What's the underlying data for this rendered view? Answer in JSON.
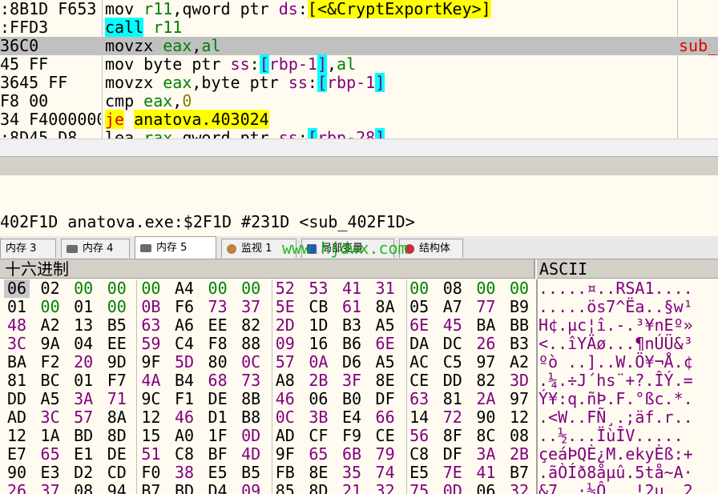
{
  "disasm": {
    "rows": [
      {
        "bytes": ":8B1D F653",
        "instr": [
          {
            "t": "mov ",
            "c": "plain"
          },
          {
            "t": "r11",
            "c": "reg"
          },
          {
            "t": ",",
            "c": "plain"
          },
          {
            "t": "qword ptr ",
            "c": "plain"
          },
          {
            "t": "ds",
            "c": "seg"
          },
          {
            "t": ":",
            "c": "plain"
          },
          {
            "t": "[<&CryptExportKey>]",
            "c": "callhl"
          }
        ],
        "selected": false,
        "comment": ""
      },
      {
        "bytes": ":FFD3",
        "instr": [
          {
            "t": "call",
            "c": "cyan"
          },
          {
            "t": " ",
            "c": "plain"
          },
          {
            "t": "r11",
            "c": "reg"
          }
        ],
        "selected": false,
        "comment": ""
      },
      {
        "bytes": "36C0",
        "instr": [
          {
            "t": "movzx ",
            "c": "plain"
          },
          {
            "t": "eax",
            "c": "reg"
          },
          {
            "t": ",",
            "c": "plain"
          },
          {
            "t": "al",
            "c": "reg"
          }
        ],
        "selected": true,
        "comment": "sub_"
      },
      {
        "bytes": "45 FF",
        "instr": [
          {
            "t": "mov ",
            "c": "plain"
          },
          {
            "t": "byte ptr ",
            "c": "plain"
          },
          {
            "t": "ss",
            "c": "seg"
          },
          {
            "t": ":",
            "c": "plain"
          },
          {
            "t": "[",
            "c": "br"
          },
          {
            "t": "rbp-1",
            "c": "mem"
          },
          {
            "t": "]",
            "c": "br"
          },
          {
            "t": ",",
            "c": "plain"
          },
          {
            "t": "al",
            "c": "reg"
          }
        ],
        "selected": false,
        "comment": ""
      },
      {
        "bytes": "3645 FF",
        "instr": [
          {
            "t": "movzx ",
            "c": "plain"
          },
          {
            "t": "eax",
            "c": "reg"
          },
          {
            "t": ",",
            "c": "plain"
          },
          {
            "t": "byte ptr ",
            "c": "plain"
          },
          {
            "t": "ss",
            "c": "seg"
          },
          {
            "t": ":",
            "c": "plain"
          },
          {
            "t": "[",
            "c": "br"
          },
          {
            "t": "rbp-1",
            "c": "mem"
          },
          {
            "t": "]",
            "c": "br"
          }
        ],
        "selected": false,
        "comment": ""
      },
      {
        "bytes": "F8 00",
        "instr": [
          {
            "t": "cmp ",
            "c": "plain"
          },
          {
            "t": "eax",
            "c": "reg"
          },
          {
            "t": ",",
            "c": "plain"
          },
          {
            "t": "0",
            "c": "num"
          }
        ],
        "selected": false,
        "comment": ""
      },
      {
        "bytes": "34 F4000000",
        "instr": [
          {
            "t": "je",
            "c": "jmp"
          },
          {
            "t": " ",
            "c": "plain"
          },
          {
            "t": "anatova.403024",
            "c": "yellow"
          }
        ],
        "selected": false,
        "comment": ""
      },
      {
        "bytes": ":8D45 D8",
        "instr": [
          {
            "t": "lea ",
            "c": "plain"
          },
          {
            "t": "rax",
            "c": "reg"
          },
          {
            "t": ",",
            "c": "plain"
          },
          {
            "t": "qword ptr ",
            "c": "plain"
          },
          {
            "t": "ss",
            "c": "seg"
          },
          {
            "t": ":",
            "c": "plain"
          },
          {
            "t": "[",
            "c": "br"
          },
          {
            "t": "rbp-28",
            "c": "mem"
          },
          {
            "t": "]",
            "c": "br"
          }
        ],
        "selected": false,
        "comment": ""
      }
    ]
  },
  "info": {
    "line": "402F1D anatova.exe:$2F1D #231D <sub_402F1D>"
  },
  "tabs": [
    {
      "label": "内存 3",
      "active": false,
      "icon": "memory-icon"
    },
    {
      "label": "内存 4",
      "active": false,
      "icon": "memory-icon"
    },
    {
      "label": "内存 5",
      "active": true,
      "icon": "memory-icon"
    },
    {
      "label": "监视 1",
      "active": false,
      "icon": "watch-icon"
    },
    {
      "label": "局部变量",
      "active": false,
      "icon": "locals-icon"
    },
    {
      "label": "结构体",
      "active": false,
      "icon": "struct-icon"
    }
  ],
  "watermark": "www.hjdwx.com",
  "hex": {
    "header": "十六进制",
    "ascii_header": "ASCII",
    "rows": [
      [
        "06",
        "02",
        "00",
        "00",
        "00",
        "A4",
        "00",
        "00",
        "52",
        "53",
        "41",
        "31",
        "00",
        "08",
        "00",
        "00"
      ],
      [
        "01",
        "00",
        "01",
        "00",
        "0B",
        "F6",
        "73",
        "37",
        "5E",
        "CB",
        "61",
        "8A",
        "05",
        "A7",
        "77",
        "B9"
      ],
      [
        "48",
        "A2",
        "13",
        "B5",
        "63",
        "A6",
        "EE",
        "82",
        "2D",
        "1D",
        "B3",
        "A5",
        "6E",
        "45",
        "BA",
        "BB"
      ],
      [
        "3C",
        "9A",
        "04",
        "EE",
        "59",
        "C4",
        "F8",
        "88",
        "09",
        "16",
        "B6",
        "6E",
        "DA",
        "DC",
        "26",
        "B3"
      ],
      [
        "BA",
        "F2",
        "20",
        "9D",
        "9F",
        "5D",
        "80",
        "0C",
        "57",
        "0A",
        "D6",
        "A5",
        "AC",
        "C5",
        "97",
        "A2"
      ],
      [
        "81",
        "BC",
        "01",
        "F7",
        "4A",
        "B4",
        "68",
        "73",
        "A8",
        "2B",
        "3F",
        "8E",
        "CE",
        "DD",
        "82",
        "3D"
      ],
      [
        "DD",
        "A5",
        "3A",
        "71",
        "9C",
        "F1",
        "DE",
        "8B",
        "46",
        "06",
        "B0",
        "DF",
        "63",
        "81",
        "2A",
        "97"
      ],
      [
        "AD",
        "3C",
        "57",
        "8A",
        "12",
        "46",
        "D1",
        "B8",
        "0C",
        "3B",
        "E4",
        "66",
        "14",
        "72",
        "90",
        "12"
      ],
      [
        "12",
        "1A",
        "BD",
        "8D",
        "15",
        "A0",
        "1F",
        "0D",
        "AD",
        "CF",
        "F9",
        "CE",
        "56",
        "8F",
        "8C",
        "08"
      ],
      [
        "E7",
        "65",
        "E1",
        "DE",
        "51",
        "C8",
        "BF",
        "4D",
        "9F",
        "65",
        "6B",
        "79",
        "C8",
        "DF",
        "3A",
        "2B"
      ],
      [
        "90",
        "E3",
        "D2",
        "CD",
        "F0",
        "38",
        "E5",
        "B5",
        "FB",
        "8E",
        "35",
        "74",
        "E5",
        "7E",
        "41",
        "B7"
      ],
      [
        "26",
        "37",
        "08",
        "94",
        "B7",
        "BD",
        "D4",
        "09",
        "85",
        "8D",
        "21",
        "32",
        "75",
        "0D",
        "06",
        "32"
      ]
    ],
    "colors": [
      [
        "blk",
        "blk",
        "grn",
        "grn",
        "grn",
        "blk",
        "grn",
        "grn",
        "pur",
        "pur",
        "pur",
        "pur",
        "grn",
        "blk",
        "grn",
        "grn"
      ],
      [
        "blk",
        "grn",
        "blk",
        "grn",
        "pur",
        "blk",
        "pur",
        "pur",
        "pur",
        "blk",
        "pur",
        "blk",
        "blk",
        "blk",
        "pur",
        "blk"
      ],
      [
        "pur",
        "blk",
        "blk",
        "blk",
        "pur",
        "blk",
        "blk",
        "blk",
        "pur",
        "blk",
        "blk",
        "blk",
        "pur",
        "pur",
        "blk",
        "blk"
      ],
      [
        "pur",
        "blk",
        "blk",
        "blk",
        "pur",
        "blk",
        "blk",
        "blk",
        "pur",
        "blk",
        "blk",
        "pur",
        "blk",
        "blk",
        "pur",
        "blk"
      ],
      [
        "blk",
        "blk",
        "pur",
        "blk",
        "blk",
        "pur",
        "blk",
        "pur",
        "pur",
        "pur",
        "blk",
        "blk",
        "blk",
        "blk",
        "blk",
        "blk"
      ],
      [
        "blk",
        "blk",
        "blk",
        "blk",
        "pur",
        "blk",
        "pur",
        "pur",
        "blk",
        "pur",
        "pur",
        "blk",
        "blk",
        "blk",
        "blk",
        "pur"
      ],
      [
        "blk",
        "blk",
        "pur",
        "pur",
        "blk",
        "blk",
        "blk",
        "blk",
        "pur",
        "blk",
        "blk",
        "blk",
        "pur",
        "blk",
        "pur",
        "blk"
      ],
      [
        "blk",
        "pur",
        "pur",
        "blk",
        "blk",
        "pur",
        "blk",
        "blk",
        "pur",
        "pur",
        "blk",
        "pur",
        "blk",
        "pur",
        "blk",
        "blk"
      ],
      [
        "blk",
        "blk",
        "blk",
        "blk",
        "blk",
        "blk",
        "blk",
        "pur",
        "blk",
        "blk",
        "blk",
        "blk",
        "pur",
        "blk",
        "blk",
        "blk"
      ],
      [
        "blk",
        "pur",
        "blk",
        "blk",
        "pur",
        "blk",
        "blk",
        "pur",
        "blk",
        "pur",
        "pur",
        "pur",
        "blk",
        "blk",
        "pur",
        "pur"
      ],
      [
        "blk",
        "blk",
        "blk",
        "blk",
        "blk",
        "pur",
        "blk",
        "blk",
        "blk",
        "blk",
        "pur",
        "pur",
        "blk",
        "pur",
        "pur",
        "blk"
      ],
      [
        "pur",
        "pur",
        "blk",
        "blk",
        "blk",
        "blk",
        "blk",
        "pur",
        "blk",
        "blk",
        "pur",
        "pur",
        "pur",
        "pur",
        "blk",
        "pur"
      ]
    ],
    "ascii": [
      ".....¤..RSA1....",
      ".....ös7^Ëa..§w¹",
      "H¢.µc¦î.-.³¥nEº»",
      "<..îYÄø...¶nÚÜ&³",
      "ºò ..]..W.Ö¥¬Å.¢",
      ".¼.÷J´hs¨+?.ÎÝ.=",
      "Ý¥:q.ñÞ.F.°ßc.*.",
      ".<W..FÑ¸.;äf.r..",
      "..½...ÏùÎV.....",
      "çeáÞQÈ¿M.ekyÈß:+",
      ".ãÒÍð8åµû.5tå~A·",
      "&7..·½Ô...!2u..2"
    ]
  },
  "colors": {
    "background": "#fffbf0",
    "selected_row": "#c0c0c0",
    "register": "#008000",
    "segment": "#800080",
    "cyan_highlight": "#00ffff",
    "yellow_highlight": "#ffff00",
    "jump": "#e00000",
    "byte_green": "#008000",
    "byte_purple": "#800080"
  }
}
